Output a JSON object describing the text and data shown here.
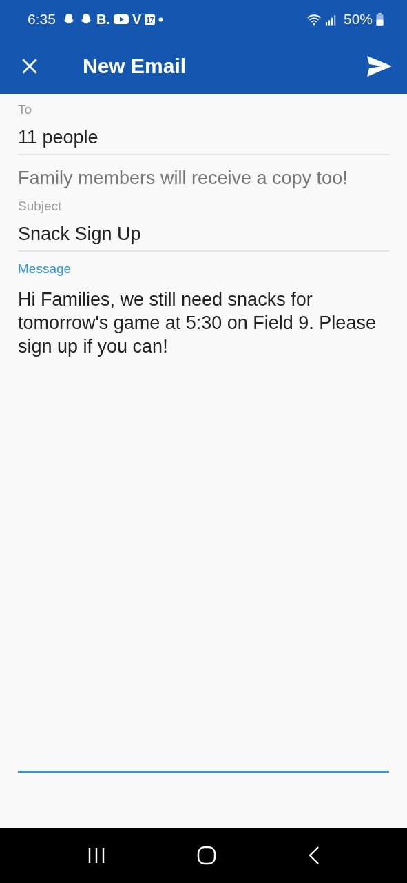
{
  "status_bar": {
    "time": "6:35",
    "notifications": [
      "B.",
      "V",
      "17"
    ],
    "battery": "50%"
  },
  "app_bar": {
    "title": "New Email"
  },
  "fields": [
    {
      "kind": "recipients",
      "label": "To",
      "value": "11 people",
      "focused": false
    },
    {
      "kind": "note",
      "text": "Family members will receive a copy too!"
    },
    {
      "kind": "line",
      "label": "Subject",
      "value": "Snack Sign Up",
      "focused": false
    },
    {
      "kind": "multiline",
      "label": "Message",
      "value": "Hi Families, we still need snacks for tomorrow's game at 5:30 on Field 9. Please sign up if you can!",
      "focused": true
    }
  ]
}
